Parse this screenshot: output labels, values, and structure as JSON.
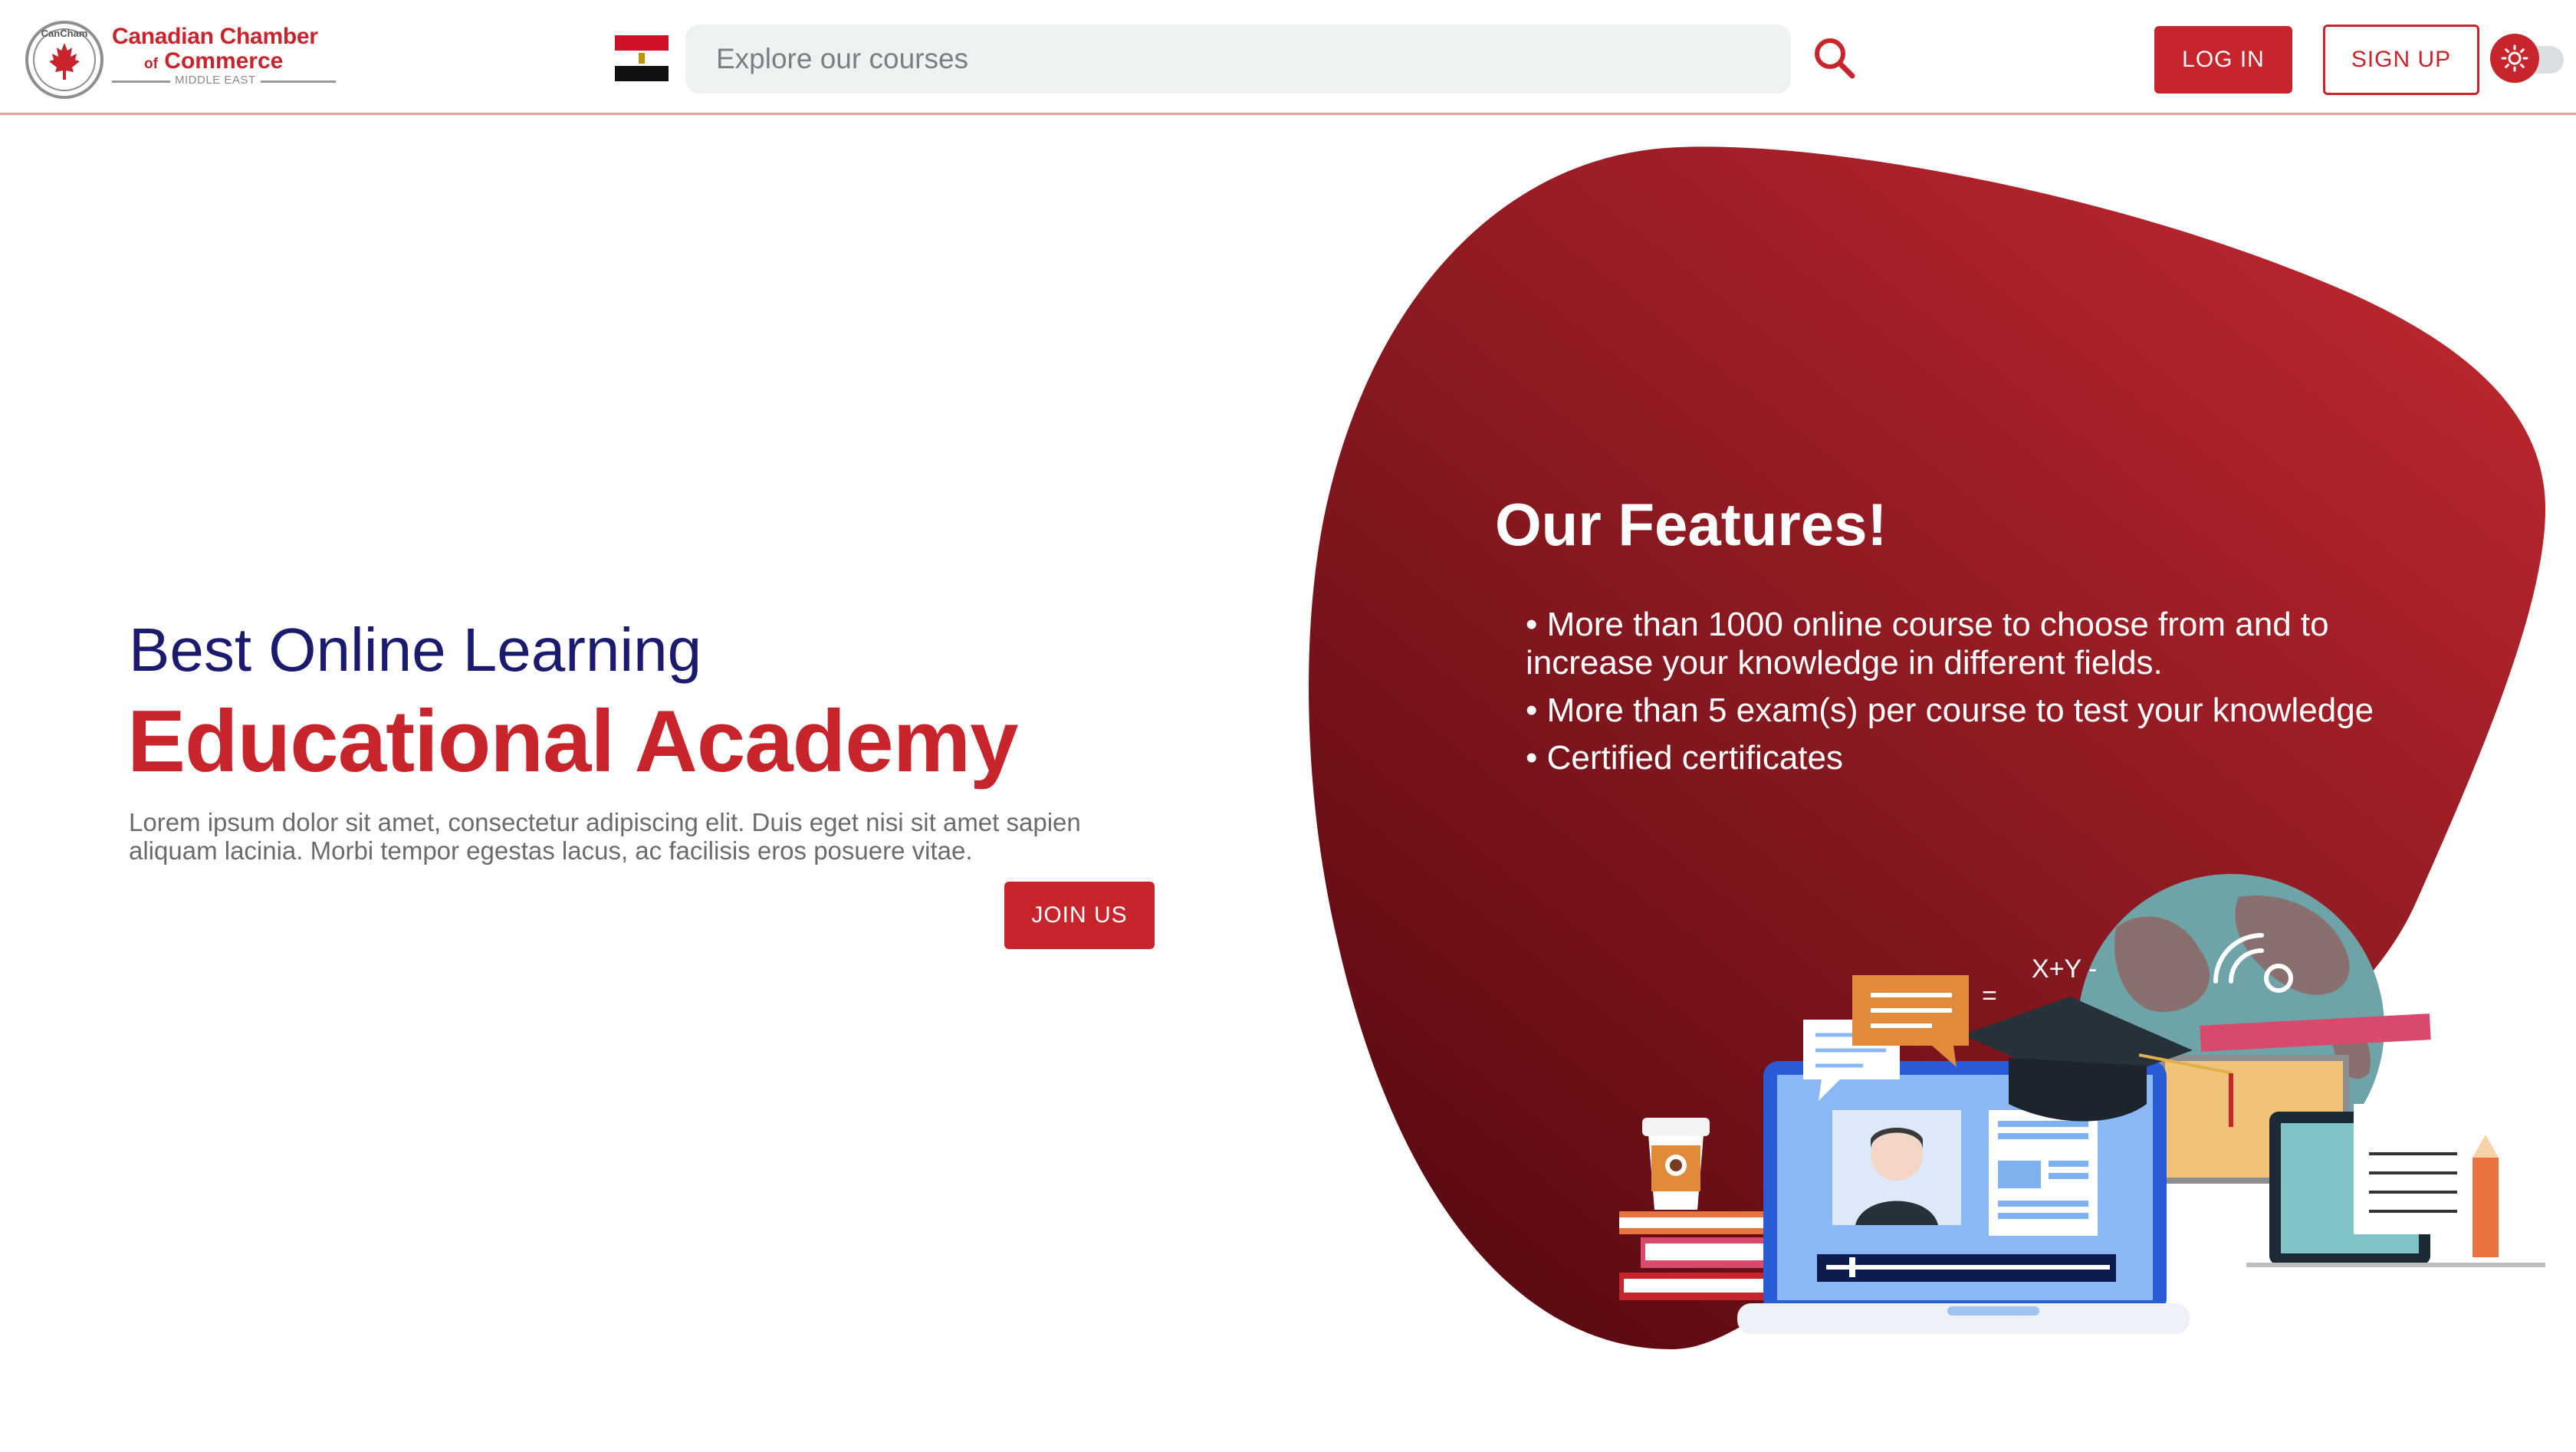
{
  "header": {
    "logo": {
      "seal_text": "CanCham",
      "title": "Canadian Chamber",
      "sub_of": "of",
      "sub_main": "Commerce",
      "region": "MIDDLE EAST"
    },
    "flag_icon": "egypt-flag-icon",
    "search": {
      "placeholder": "Explore our courses",
      "value": "",
      "icon": "search-icon"
    },
    "login_label": "LOG IN",
    "signup_label": "SIGN UP",
    "theme_toggle_icon": "sun-icon"
  },
  "hero": {
    "subtitle": "Best Online Learning",
    "title": "Educational Academy",
    "description": "Lorem ipsum dolor sit amet, consectetur adipiscing elit. Duis eget nisi sit amet sapien aliquam lacinia. Morbi tempor egestas lacus, ac facilisis eros posuere vitae.",
    "cta_label": "JOIN US"
  },
  "features": {
    "title": "Our Features!",
    "items": [
      "• More than 1000 online course to choose from and to increase your knowledge in different fields.",
      "• More than 5 exam(s) per course to test your knowledge",
      "• Certified certificates"
    ]
  },
  "illustration": {
    "formula_text": "X+Y -",
    "equals_text": "=",
    "plus_text": "+",
    "question_text": "?"
  },
  "colors": {
    "brand_red": "#c8242b",
    "navy": "#1a1a6e",
    "blob_dark": "#5c0a12",
    "blob_light": "#b8252d",
    "search_bg": "#eef2f3"
  }
}
